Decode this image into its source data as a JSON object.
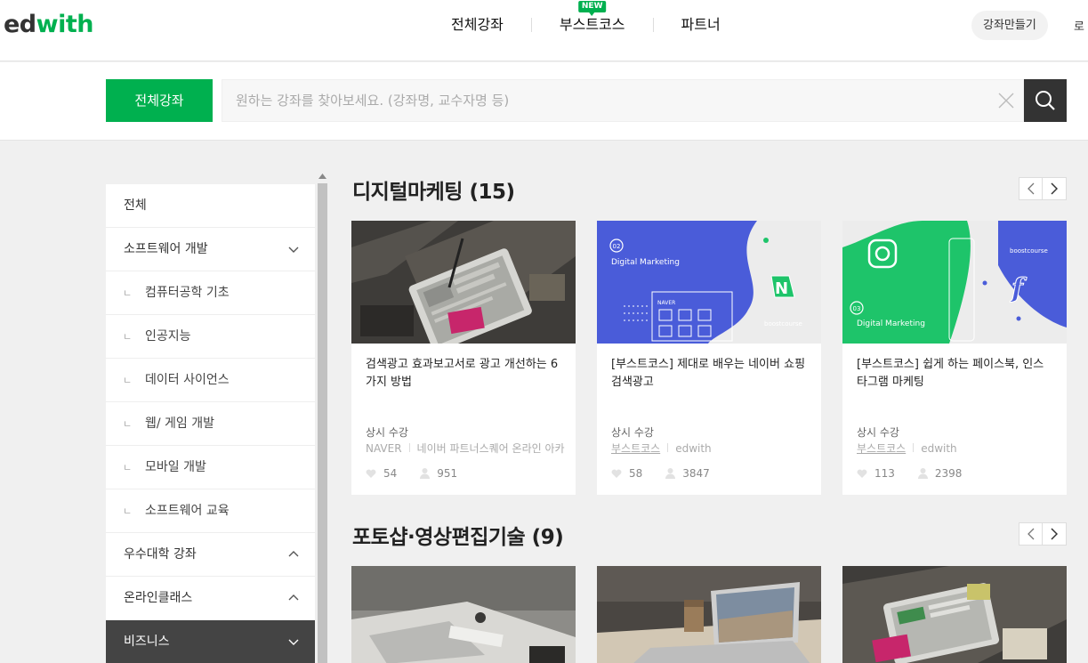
{
  "header": {
    "logo_ed": "ed",
    "logo_with": "with",
    "nav": [
      {
        "label": "전체강좌"
      },
      {
        "label": "부스트코스",
        "badge": "NEW"
      },
      {
        "label": "파트너"
      }
    ],
    "make_course": "강좌만들기",
    "login": "로"
  },
  "search": {
    "category_button": "전체강좌",
    "placeholder": "원하는 강좌를 찾아보세요. (강좌명, 교수자명 등)"
  },
  "sidebar": {
    "items": [
      {
        "label": "전체",
        "type": "top"
      },
      {
        "label": "소프트웨어 개발",
        "type": "top",
        "chevron": "down"
      },
      {
        "label": "컴퓨터공학 기초",
        "type": "sub"
      },
      {
        "label": "인공지능",
        "type": "sub"
      },
      {
        "label": "데이터 사이언스",
        "type": "sub"
      },
      {
        "label": "웹/ 게임 개발",
        "type": "sub"
      },
      {
        "label": "모바일 개발",
        "type": "sub"
      },
      {
        "label": "소프트웨어 교육",
        "type": "sub"
      },
      {
        "label": "우수대학 강좌",
        "type": "top",
        "chevron": "up"
      },
      {
        "label": "온라인클래스",
        "type": "top",
        "chevron": "up"
      },
      {
        "label": "비즈니스",
        "type": "top",
        "chevron": "down",
        "active": true
      }
    ],
    "sub_tick": "ㄴ"
  },
  "sections": [
    {
      "title": "디지털마케팅 (15)",
      "cards": [
        {
          "title": "검색광고 효과보고서로 광고 개선하는 6가지 방법",
          "status": "상시 수강",
          "org1": "NAVER",
          "org2": "네이버 파트너스퀘어 온라인 아카",
          "likes": "54",
          "students": "951"
        },
        {
          "title": "[부스트코스] 제대로 배우는 네이버 쇼핑검색광고",
          "status": "상시 수강",
          "org1": "부스트코스",
          "org2": "edwith",
          "likes": "58",
          "students": "3847",
          "thumb_label": "Digital Marketing",
          "thumb_num": "02",
          "thumb_brand": "boostcourse",
          "thumb_naver": "NAVER"
        },
        {
          "title": "[부스트코스] 쉽게 하는 페이스북, 인스타그램 마케팅",
          "status": "상시 수강",
          "org1": "부스트코스",
          "org2": "edwith",
          "likes": "113",
          "students": "2398",
          "thumb_label": "Digital Marketing",
          "thumb_num": "03",
          "thumb_brand": "boostcourse"
        }
      ]
    },
    {
      "title": "포토샵·영상편집기술 (9)"
    }
  ],
  "colors": {
    "brand_green": "#00b04f",
    "dark": "#333333",
    "card_blue": "#4a5cd9",
    "card_green": "#1ec46a"
  }
}
